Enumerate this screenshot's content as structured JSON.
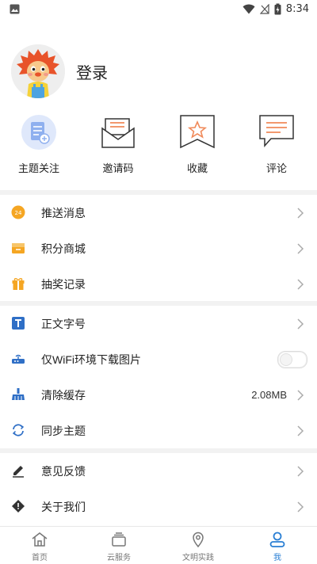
{
  "status_bar": {
    "time": "8:34",
    "icons": [
      "image-icon",
      "wifi-icon",
      "no-signal-icon",
      "battery-charging-icon"
    ]
  },
  "profile": {
    "login_label": "登录",
    "avatar_icon": "lion-mascot-avatar"
  },
  "quick_actions": [
    {
      "label": "主题关注",
      "icon": "topic-follow-icon"
    },
    {
      "label": "邀请码",
      "icon": "invite-envelope-icon"
    },
    {
      "label": "收藏",
      "icon": "star-bookmark-icon"
    },
    {
      "label": "评论",
      "icon": "comment-bubble-icon"
    }
  ],
  "menu_group1": [
    {
      "label": "推送消息",
      "icon": "push-badge-icon"
    },
    {
      "label": "积分商城",
      "icon": "points-mall-icon"
    },
    {
      "label": "抽奖记录",
      "icon": "gift-icon"
    }
  ],
  "menu_group2": [
    {
      "label": "正文字号",
      "icon": "font-size-icon"
    },
    {
      "label": "仅WiFi环境下载图片",
      "icon": "router-icon",
      "toggle_on": false
    },
    {
      "label": "清除缓存",
      "icon": "broom-icon",
      "value": "2.08MB"
    },
    {
      "label": "同步主题",
      "icon": "sync-icon"
    }
  ],
  "menu_group3": [
    {
      "label": "意见反馈",
      "icon": "pencil-icon"
    },
    {
      "label": "关于我们",
      "icon": "info-diamond-icon"
    }
  ],
  "tab_bar": [
    {
      "label": "首页",
      "icon": "home-icon"
    },
    {
      "label": "云服务",
      "icon": "cloud-service-icon"
    },
    {
      "label": "文明实践",
      "icon": "location-pin-icon"
    },
    {
      "label": "我",
      "icon": "person-icon",
      "active": true
    }
  ],
  "colors": {
    "accent": "#2a7fd4",
    "orange": "#f5a623",
    "separator": "#f2f2f2",
    "icon_blue": "#2f6fc6",
    "quick_icon": "#f08a5a"
  }
}
